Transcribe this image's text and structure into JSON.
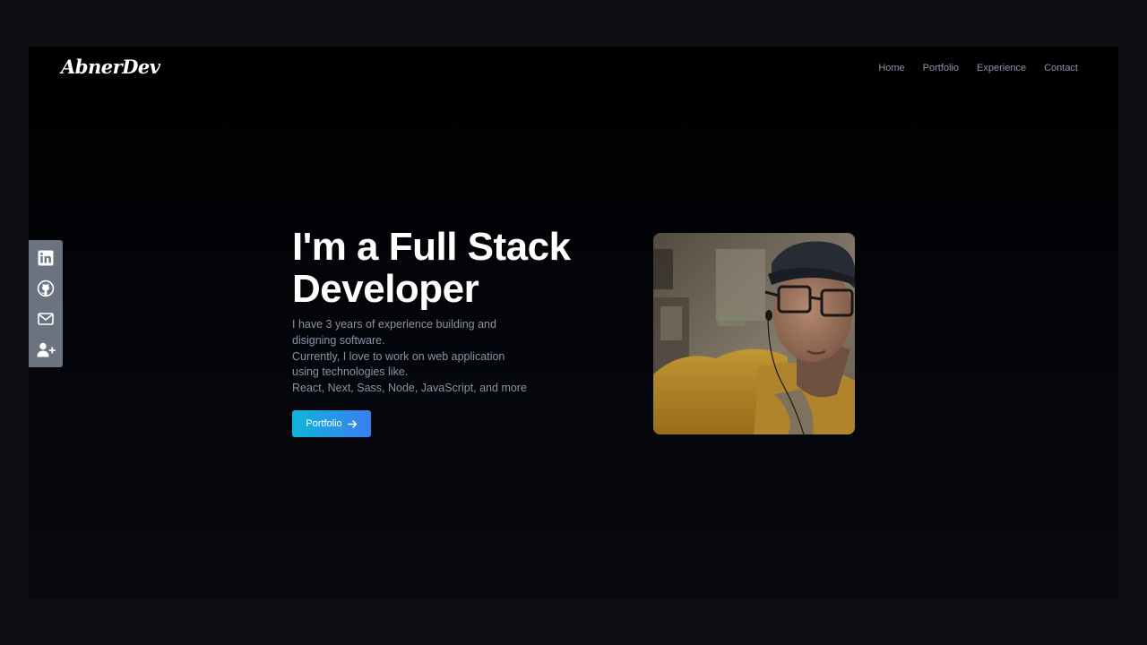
{
  "brand": {
    "logo_text": "AbnerDev"
  },
  "nav": {
    "items": [
      {
        "label": "Home"
      },
      {
        "label": "Portfolio"
      },
      {
        "label": "Experience"
      },
      {
        "label": "Contact"
      }
    ]
  },
  "social": {
    "icons": [
      "linkedin-icon",
      "github-icon",
      "mail-icon",
      "user-plus-icon"
    ]
  },
  "hero": {
    "title_line1": "I'm a Full Stack",
    "title_line2": "Developer",
    "description_lines": [
      "I have 3 years of experience building and",
      "disigning software.",
      "Currently, I love to work on web application",
      "using technologies like.",
      "React, Next, Sass, Node, JavaScript, and more"
    ],
    "cta_label": "Portfolio",
    "cta_icon": "arrow-right-icon"
  },
  "colors": {
    "background": "#000000",
    "accent_start": "#0fb5d9",
    "accent_end": "#3a7ef0",
    "nav_text": "#8a94a6",
    "sidebar_bg": "#6b7280"
  }
}
